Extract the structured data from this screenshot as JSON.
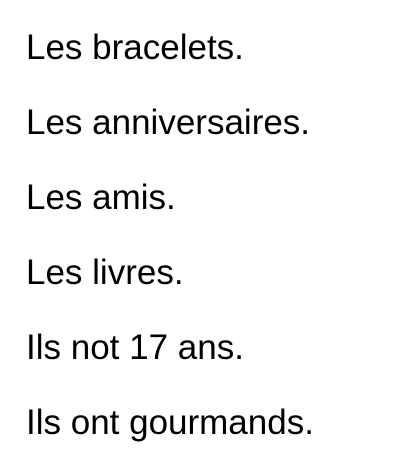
{
  "document": {
    "lines": [
      "Les bracelets.",
      "Les anniversaires.",
      "Les amis.",
      "Les livres.",
      "Ils not 17 ans.",
      "Ils ont gourmands."
    ]
  }
}
